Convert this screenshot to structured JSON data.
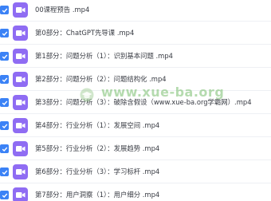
{
  "colors": {
    "checkbox": "#3b82f6",
    "video_icon": "#8f6cf3",
    "watermark": "#78be6e"
  },
  "files": [
    {
      "name": "00课程预告 .mp4",
      "checked": true,
      "icon": "video-icon"
    },
    {
      "name": "第0部分：ChatGPT先导课 .mp4",
      "checked": true,
      "icon": "video-icon"
    },
    {
      "name": "第1部分：问题分析（1）：识别基本问题 .mp4",
      "checked": true,
      "icon": "video-icon"
    },
    {
      "name": "第2部分：问题分析（2）：问题结构化 .mp4",
      "checked": true,
      "icon": "video-icon"
    },
    {
      "name": "第3部分：问题分析（3）：破除含假设（www.xue-ba.org学霸网）.mp4",
      "checked": true,
      "icon": "video-icon"
    },
    {
      "name": "第4部分：行业分析（1）：发展空间 .mp4",
      "checked": true,
      "icon": "video-icon"
    },
    {
      "name": "第5部分：行业分析（2）：发展趋势 .mp4",
      "checked": true,
      "icon": "video-icon"
    },
    {
      "name": "第6部分：行业分析（3）：学习标杆 .mp4",
      "checked": true,
      "icon": "video-icon"
    },
    {
      "name": "第7部分：用户洞察（1）：用户细分 .mp4",
      "checked": true,
      "icon": "video-icon"
    }
  ],
  "watermark": {
    "text": "www.xue-ba.org",
    "icon": "graduation-cap-icon"
  }
}
